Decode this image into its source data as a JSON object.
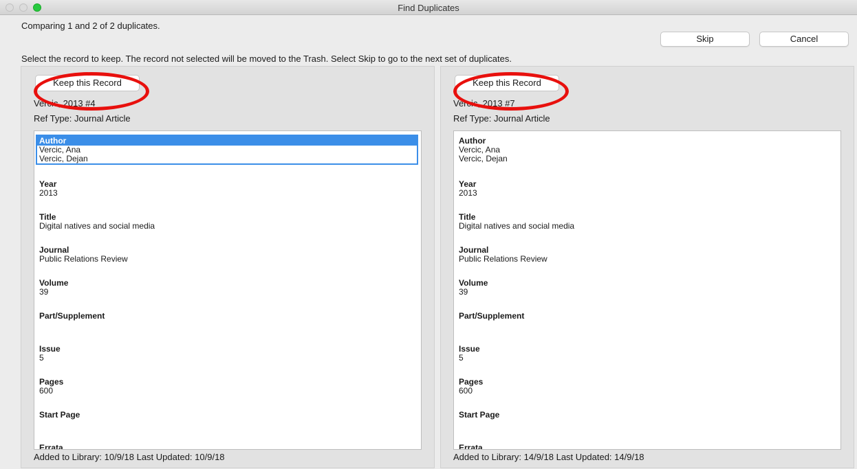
{
  "window": {
    "title": "Find Duplicates"
  },
  "status_text": "Comparing 1 and 2 of 2 duplicates.",
  "instructions_text": "Select the record to keep. The record not selected will be moved to the Trash. Select Skip to go to the next set of duplicates.",
  "buttons": {
    "skip_label": "Skip",
    "cancel_label": "Cancel"
  },
  "colors": {
    "highlight_circle": "#e8100d",
    "selection": "#3b8ee8"
  },
  "records": [
    {
      "keep_label": "Keep this Record",
      "ref_id": "Vercic, 2013 #4",
      "ref_type": "Ref Type:  Journal Article",
      "selected_field": "Author",
      "fields": [
        {
          "label": "Author",
          "value": "Vercic, Ana\nVercic, Dejan"
        },
        {
          "label": "Year",
          "value": "2013"
        },
        {
          "label": "Title",
          "value": "Digital natives and social media"
        },
        {
          "label": "Journal",
          "value": "Public Relations Review"
        },
        {
          "label": "Volume",
          "value": "39"
        },
        {
          "label": "Part/Supplement",
          "value": ""
        },
        {
          "label": "Issue",
          "value": "5"
        },
        {
          "label": "Pages",
          "value": "600"
        },
        {
          "label": "Start Page",
          "value": ""
        },
        {
          "label": "Errata",
          "value": ""
        }
      ],
      "footer": "Added to Library: 10/9/18    Last Updated: 10/9/18"
    },
    {
      "keep_label": "Keep this Record",
      "ref_id": "Vercic, 2013 #7",
      "ref_type": "Ref Type:  Journal Article",
      "selected_field": "",
      "fields": [
        {
          "label": "Author",
          "value": "Vercic, Ana\nVercic, Dejan"
        },
        {
          "label": "Year",
          "value": "2013"
        },
        {
          "label": "Title",
          "value": "Digital natives and social media"
        },
        {
          "label": "Journal",
          "value": "Public Relations Review"
        },
        {
          "label": "Volume",
          "value": "39"
        },
        {
          "label": "Part/Supplement",
          "value": ""
        },
        {
          "label": "Issue",
          "value": "5"
        },
        {
          "label": "Pages",
          "value": "600"
        },
        {
          "label": "Start Page",
          "value": ""
        },
        {
          "label": "Errata",
          "value": ""
        }
      ],
      "footer": "Added to Library: 14/9/18    Last Updated: 14/9/18"
    }
  ]
}
